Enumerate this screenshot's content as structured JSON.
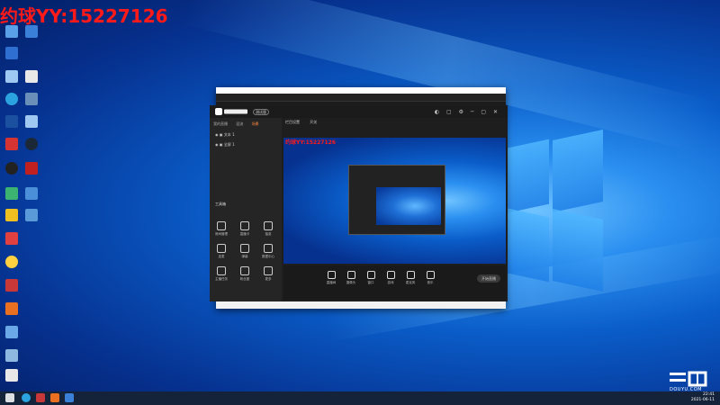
{
  "watermark": {
    "text": "约球YY:15227126"
  },
  "colors": {
    "watermark": "#ff1a1a",
    "accent": "#ff8a3d",
    "desktop": "#0a5cc8"
  },
  "app": {
    "title": "直播伴侣",
    "badge": "测试版",
    "tabs": [
      "我的直播",
      "混流",
      "场景"
    ],
    "active_tab": "场景",
    "scenes": [
      "文本 1",
      "全屏 1"
    ],
    "right_tabs": [
      "栏目设置",
      "开关"
    ],
    "tools_title": "工具箱",
    "tools": [
      {
        "label": "房间管理",
        "icon": "gear-icon"
      },
      {
        "label": "直播卡",
        "icon": "card-icon"
      },
      {
        "label": "抽奖",
        "icon": "gift-icon"
      },
      {
        "label": "连麦",
        "icon": "mic-icon"
      },
      {
        "label": "弹幕",
        "icon": "chat-icon"
      },
      {
        "label": "数据中心",
        "icon": "chart-icon"
      },
      {
        "label": "主播任务",
        "icon": "task-icon"
      },
      {
        "label": "粉丝团",
        "icon": "fans-icon"
      },
      {
        "label": "更多",
        "icon": "more-icon"
      }
    ],
    "controls": [
      {
        "label": "直播间",
        "icon": "screen-icon"
      },
      {
        "label": "摄像头",
        "icon": "camera-icon"
      },
      {
        "label": "窗口",
        "icon": "window-icon"
      },
      {
        "label": "游戏",
        "icon": "game-icon"
      },
      {
        "label": "麦克风",
        "icon": "mic-icon"
      },
      {
        "label": "音乐",
        "icon": "music-icon"
      }
    ],
    "go_live": "开始直播"
  },
  "taskbar": {
    "time": "22:41",
    "date": "2021-06-11"
  },
  "douyu": {
    "logo_text": "斗鱼",
    "url_text": "DOUYU.COM"
  }
}
